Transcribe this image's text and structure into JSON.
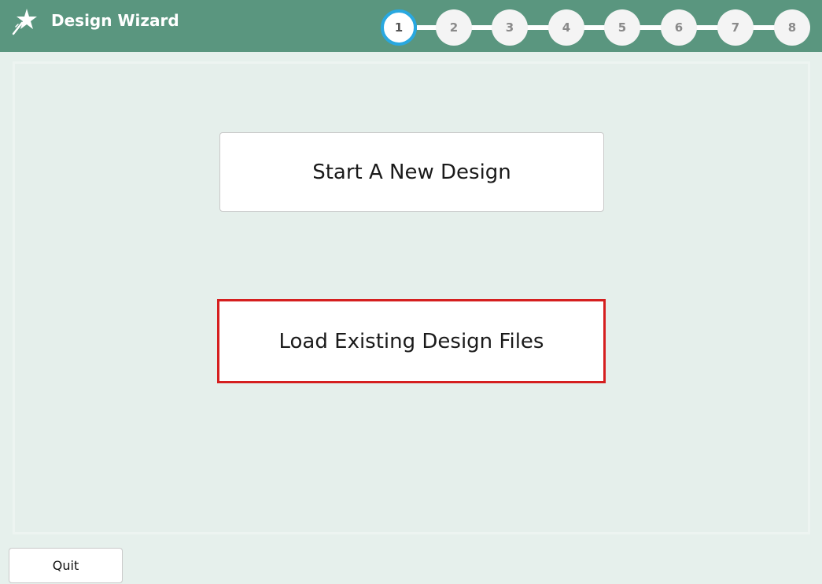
{
  "header": {
    "title": "Design Wizard",
    "logo_icon": "magic-wand-icon",
    "background_color": "#5a967f"
  },
  "stepper": {
    "active_step": 1,
    "active_color": "#29a8e0",
    "steps": [
      {
        "label": "1",
        "active": true
      },
      {
        "label": "2",
        "active": false
      },
      {
        "label": "3",
        "active": false
      },
      {
        "label": "4",
        "active": false
      },
      {
        "label": "5",
        "active": false
      },
      {
        "label": "6",
        "active": false
      },
      {
        "label": "7",
        "active": false
      },
      {
        "label": "8",
        "active": false
      }
    ]
  },
  "main": {
    "start_new_label": "Start A New Design",
    "load_existing_label": "Load Existing Design Files",
    "highlight_color": "#d51f1f"
  },
  "footer": {
    "quit_label": "Quit"
  }
}
